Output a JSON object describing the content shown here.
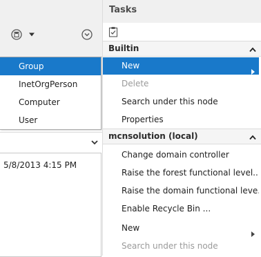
{
  "left_pane": {
    "icons": [
      "save-icon",
      "dropdown-arrow-icon",
      "circle-chevron-down-icon"
    ],
    "dropdown_items": [
      {
        "label": "Group",
        "selected": true
      },
      {
        "label": "InetOrgPerson",
        "selected": false
      },
      {
        "label": "Computer",
        "selected": false
      },
      {
        "label": "User",
        "selected": false
      }
    ],
    "date_value": "5/8/2013 4:15 PM"
  },
  "tasks": {
    "title": "Tasks",
    "sections": [
      {
        "label": "Builtin",
        "items": [
          {
            "label": "New",
            "selected": true,
            "disabled": false,
            "submenu": true
          },
          {
            "label": "Delete",
            "selected": false,
            "disabled": true,
            "submenu": false
          },
          {
            "label": "Search under this node",
            "selected": false,
            "disabled": false,
            "submenu": false
          },
          {
            "label": "Properties",
            "selected": false,
            "disabled": false,
            "submenu": false
          }
        ]
      },
      {
        "label": "mcnsolution (local)",
        "items": [
          {
            "label": "Change domain controller",
            "disabled": false,
            "submenu": false
          },
          {
            "label": "Raise the forest functional level...",
            "disabled": false,
            "submenu": false
          },
          {
            "label": "Raise the domain functional leve...",
            "disabled": false,
            "submenu": false
          },
          {
            "label": "Enable Recycle Bin ...",
            "disabled": false,
            "submenu": false
          },
          {
            "label": "New",
            "disabled": false,
            "submenu": true
          },
          {
            "label": "Search under this node",
            "disabled": true,
            "submenu": false
          }
        ]
      }
    ]
  },
  "colors": {
    "selection": "#1979ca",
    "header_bg": "#f0f0f0",
    "disabled_text": "#9a9a9a"
  }
}
